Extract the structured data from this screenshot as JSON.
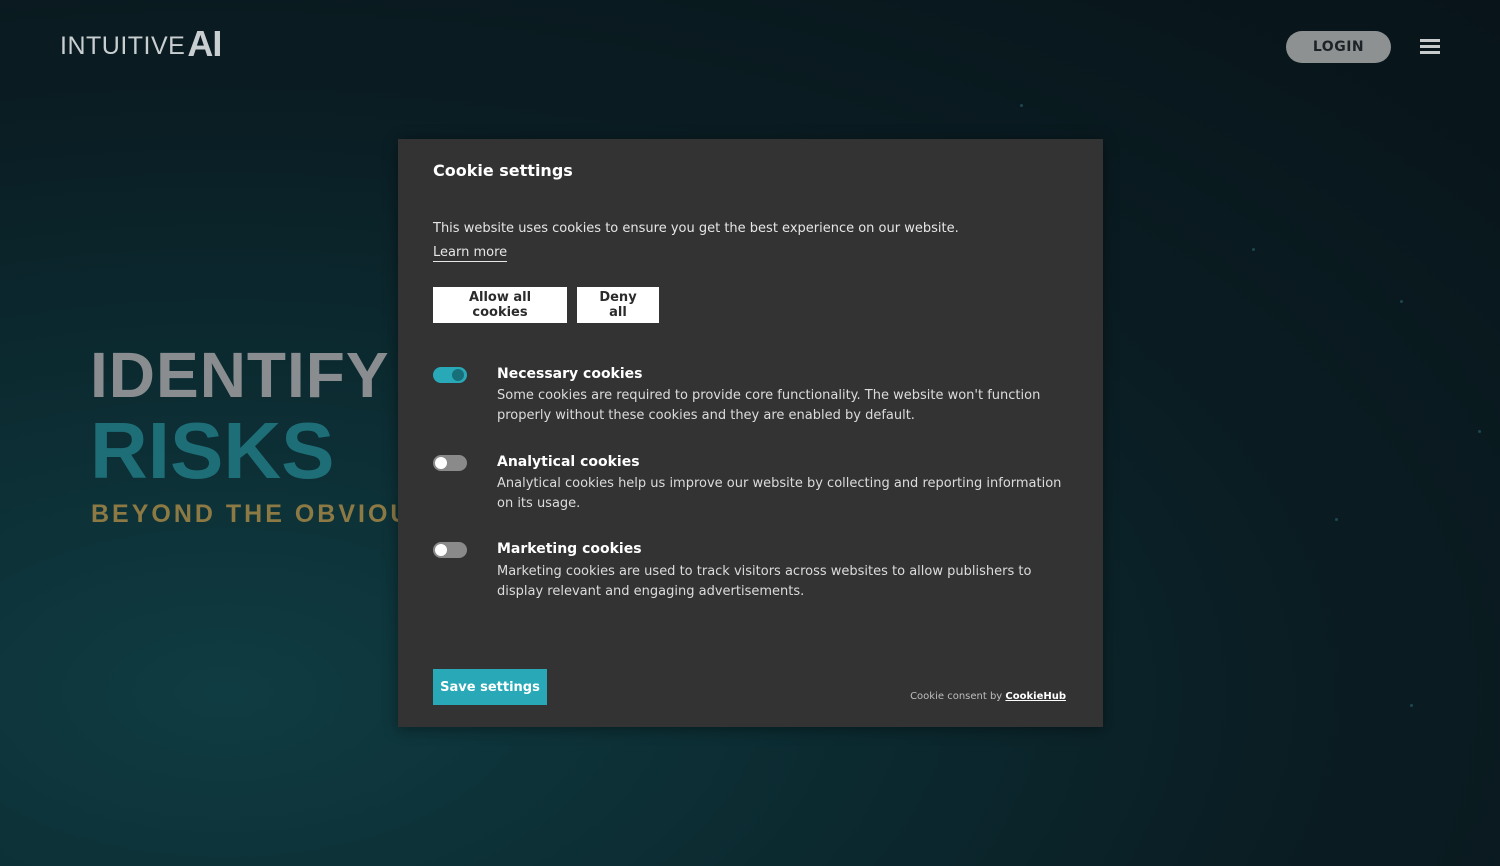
{
  "header": {
    "logo_word": "INTUITIVE",
    "logo_ai": "AI",
    "login_label": "LOGIN",
    "menu_icon": "hamburger-menu-icon"
  },
  "hero": {
    "line1": "IDENTIFY",
    "line2": "RISKS",
    "line3": "BEYOND THE OBVIOU"
  },
  "cookie_dialog": {
    "title": "Cookie settings",
    "intro": "This website uses cookies to ensure you get the best experience on our website.",
    "learn_more": "Learn more",
    "allow_all": "Allow all cookies",
    "deny_all": "Deny all",
    "sections": [
      {
        "title": "Necessary cookies",
        "description": "Some cookies are required to provide core functionality. The website won't function properly without these cookies and they are enabled by default.",
        "enabled": true
      },
      {
        "title": "Analytical cookies",
        "description": "Analytical cookies help us improve our website by collecting and reporting information on its usage.",
        "enabled": false
      },
      {
        "title": "Marketing cookies",
        "description": "Marketing cookies are used to track visitors across websites to allow publishers to display relevant and engaging advertisements.",
        "enabled": false
      }
    ],
    "save_label": "Save settings",
    "consent_prefix": "Cookie consent by ",
    "consent_brand": "CookieHub"
  },
  "colors": {
    "accent": "#29a9b7",
    "dialog_bg": "#333333",
    "hero_teal": "#1e6e78",
    "hero_gold": "#8c7944"
  }
}
